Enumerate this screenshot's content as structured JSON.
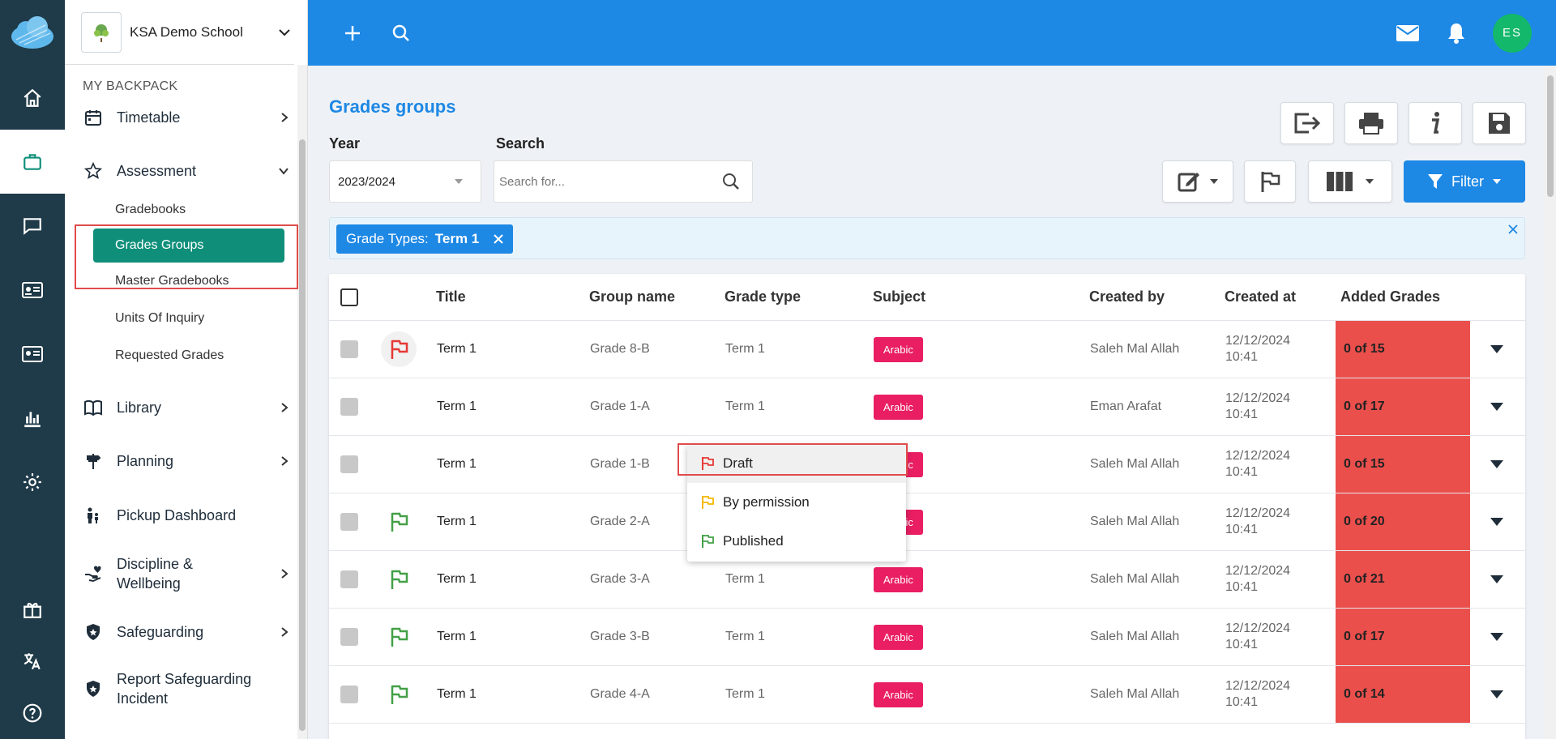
{
  "school": {
    "name": "KSA Demo School"
  },
  "rail": {
    "items": [
      "home-icon",
      "backpack-icon",
      "chat-icon",
      "id-card-icon",
      "contact-card-icon",
      "bar-chart-icon",
      "gear-icon"
    ],
    "bottom": [
      "gift-icon",
      "translate-icon",
      "help-icon"
    ]
  },
  "sidebar": {
    "section": "MY BACKPACK",
    "timetable": "Timetable",
    "assessment": "Assessment",
    "sub": [
      "Gradebooks",
      "Grades Groups",
      "Master Gradebooks",
      "Units Of Inquiry",
      "Requested Grades"
    ],
    "library": "Library",
    "planning": "Planning",
    "pickup": "Pickup Dashboard",
    "discipline": "Discipline &",
    "discipline2": "Wellbeing",
    "safeguarding": "Safeguarding",
    "report": "Report Safeguarding",
    "report2": "Incident"
  },
  "topbar": {
    "avatar": "ES"
  },
  "page": {
    "title": "Grades groups",
    "year_label": "Year",
    "year_value": "2023/2024",
    "search_label": "Search",
    "search_placeholder": "Search for...",
    "filter_label": "Filter",
    "chip_key": "Grade Types:",
    "chip_value": "Term 1"
  },
  "table": {
    "headers": [
      "Title",
      "Group name",
      "Grade type",
      "Subject",
      "Created by",
      "Created at",
      "Added Grades"
    ],
    "rows": [
      {
        "title": "Term 1",
        "group": "Grade 8-B",
        "type": "Term 1",
        "subject": "Arabic",
        "by": "Saleh Mal Allah",
        "date": "12/12/2024",
        "time": "10:41",
        "grades": "0 of 15",
        "flag": "red"
      },
      {
        "title": "Term 1",
        "group": "Grade 1-A",
        "type": "Term 1",
        "subject": "Arabic",
        "by": "Eman Arafat",
        "date": "12/12/2024",
        "time": "10:41",
        "grades": "0 of 17",
        "flag": "hidden"
      },
      {
        "title": "Term 1",
        "group": "Grade 1-B",
        "type": "Term 1",
        "subject": "Arabic",
        "by": "Saleh Mal Allah",
        "date": "12/12/2024",
        "time": "10:41",
        "grades": "0 of 15",
        "flag": "hidden"
      },
      {
        "title": "Term 1",
        "group": "Grade 2-A",
        "type": "Term 1",
        "subject": "Arabic",
        "by": "Saleh Mal Allah",
        "date": "12/12/2024",
        "time": "10:41",
        "grades": "0 of 20",
        "flag": "green"
      },
      {
        "title": "Term 1",
        "group": "Grade 3-A",
        "type": "Term 1",
        "subject": "Arabic",
        "by": "Saleh Mal Allah",
        "date": "12/12/2024",
        "time": "10:41",
        "grades": "0 of 21",
        "flag": "green"
      },
      {
        "title": "Term 1",
        "group": "Grade 3-B",
        "type": "Term 1",
        "subject": "Arabic",
        "by": "Saleh Mal Allah",
        "date": "12/12/2024",
        "time": "10:41",
        "grades": "0 of 17",
        "flag": "green"
      },
      {
        "title": "Term 1",
        "group": "Grade 4-A",
        "type": "Term 1",
        "subject": "Arabic",
        "by": "Saleh Mal Allah",
        "date": "12/12/2024",
        "time": "10:41",
        "grades": "0 of 14",
        "flag": "green"
      }
    ]
  },
  "status_menu": {
    "items": [
      {
        "label": "Draft",
        "color": "#e53935"
      },
      {
        "label": "By permission",
        "color": "#f5b800"
      },
      {
        "label": "Published",
        "color": "#43a047"
      }
    ]
  },
  "colors": {
    "primary": "#1e88e5",
    "rail": "#1f3a48",
    "active": "#0f8f7a",
    "grades_bg": "#eb4f4c",
    "badge": "#e91e63"
  }
}
